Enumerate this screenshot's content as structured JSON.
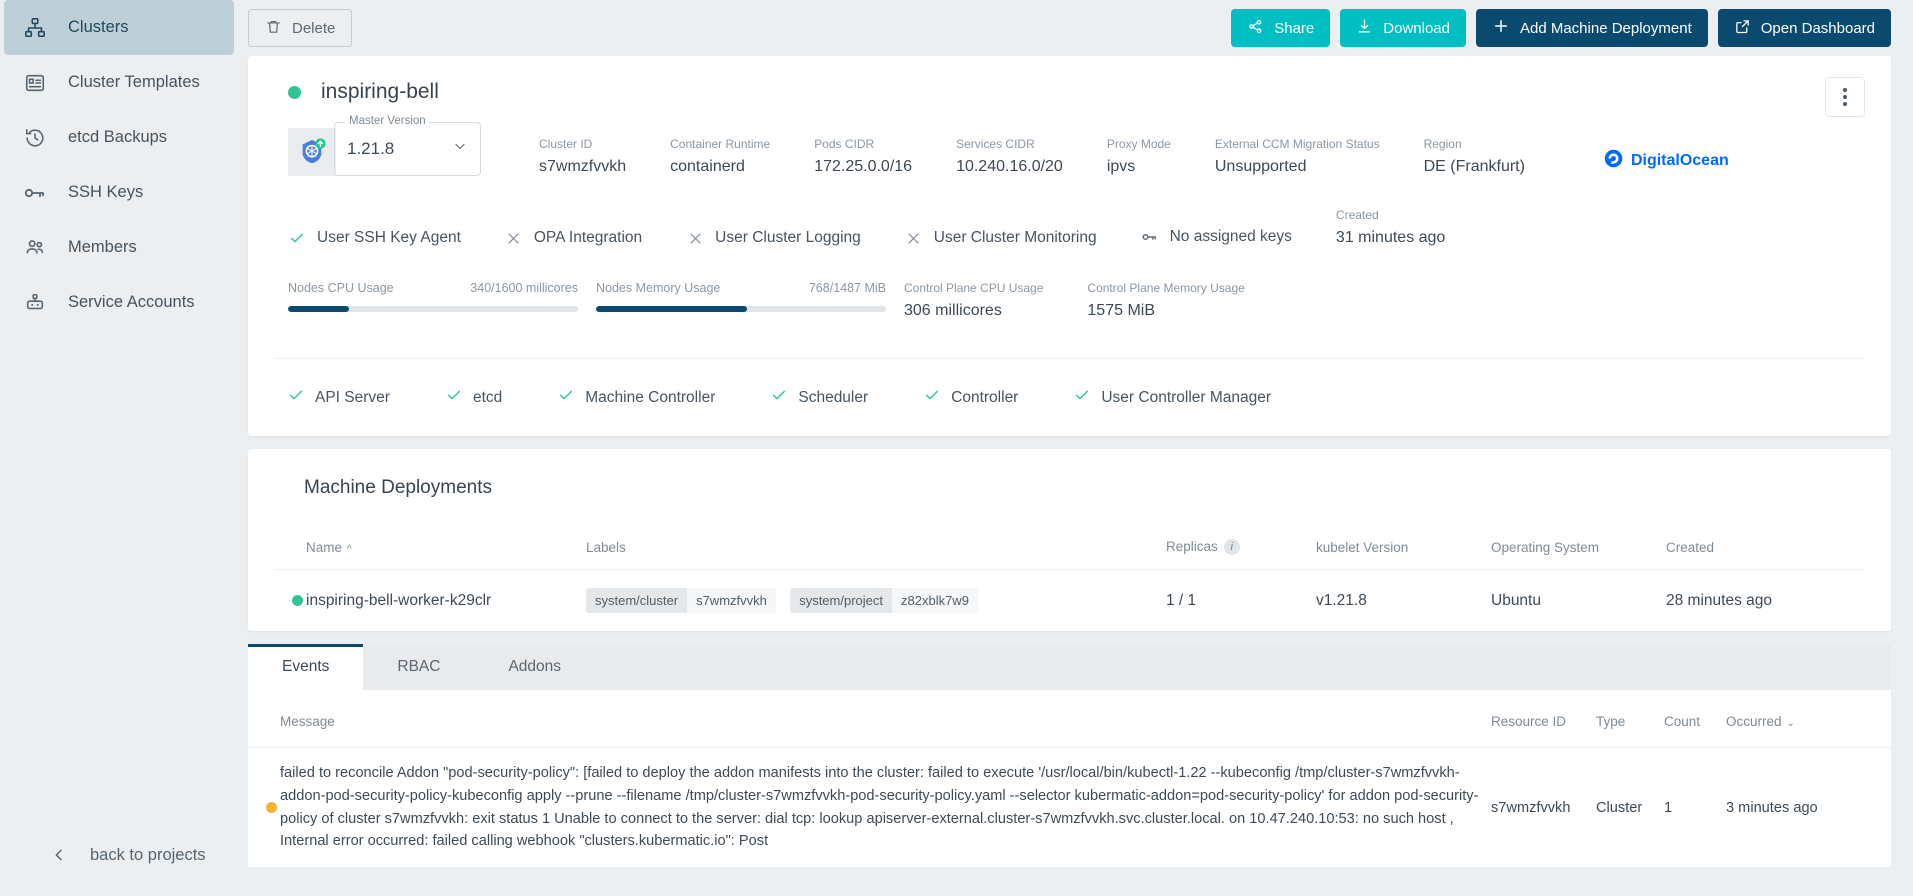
{
  "sidebar": {
    "items": [
      {
        "label": "Clusters",
        "icon": "clusters-icon",
        "active": true
      },
      {
        "label": "Cluster Templates",
        "icon": "template-icon",
        "active": false
      },
      {
        "label": "etcd Backups",
        "icon": "history-icon",
        "active": false
      },
      {
        "label": "SSH Keys",
        "icon": "key-icon",
        "active": false
      },
      {
        "label": "Members",
        "icon": "people-icon",
        "active": false
      },
      {
        "label": "Service Accounts",
        "icon": "robot-icon",
        "active": false
      }
    ],
    "back_label": "back to projects"
  },
  "toolbar": {
    "delete_label": "Delete",
    "share_label": "Share",
    "download_label": "Download",
    "add_md_label": "Add Machine Deployment",
    "open_dashboard_label": "Open Dashboard"
  },
  "cluster": {
    "name": "inspiring-bell",
    "status_color": "#30c691",
    "master_version_label": "Master Version",
    "master_version": "1.21.8",
    "meta": [
      {
        "label": "Cluster ID",
        "value": "s7wmzfvvkh"
      },
      {
        "label": "Container Runtime",
        "value": "containerd"
      },
      {
        "label": "Pods CIDR",
        "value": "172.25.0.0/16"
      },
      {
        "label": "Services CIDR",
        "value": "10.240.16.0/20"
      },
      {
        "label": "Proxy Mode",
        "value": "ipvs"
      },
      {
        "label": "External CCM Migration Status",
        "value": "Unsupported"
      },
      {
        "label": "Region",
        "value": "DE (Frankfurt)"
      }
    ],
    "provider": "DigitalOcean",
    "features": [
      {
        "label": "User SSH Key Agent",
        "state": "check"
      },
      {
        "label": "OPA Integration",
        "state": "cross"
      },
      {
        "label": "User Cluster Logging",
        "state": "cross"
      },
      {
        "label": "User Cluster Monitoring",
        "state": "cross"
      },
      {
        "label": "No assigned keys",
        "state": "key"
      }
    ],
    "created_label": "Created",
    "created_value": "31 minutes ago",
    "usage": [
      {
        "label": "Nodes CPU Usage",
        "value": "340/1600 millicores",
        "percent": 21
      },
      {
        "label": "Nodes Memory Usage",
        "value": "768/1487 MiB",
        "percent": 52
      }
    ],
    "usage_simple": [
      {
        "label": "Control Plane CPU Usage",
        "value": "306 millicores"
      },
      {
        "label": "Control Plane Memory Usage",
        "value": "1575 MiB"
      }
    ],
    "components": [
      "API Server",
      "etcd",
      "Machine Controller",
      "Scheduler",
      "Controller",
      "User Controller Manager"
    ]
  },
  "machine_deployments": {
    "title": "Machine Deployments",
    "columns": [
      "Name",
      "Labels",
      "Replicas",
      "kubelet Version",
      "Operating System",
      "Created"
    ],
    "sort_column": "Name",
    "sort_caret": "^",
    "rows": [
      {
        "status_color": "#30c691",
        "name": "inspiring-bell-worker-k29clr",
        "labels": [
          {
            "key": "system/cluster",
            "value": "s7wmzfvvkh"
          },
          {
            "key": "system/project",
            "value": "z82xblk7w9"
          }
        ],
        "replicas": "1 / 1",
        "kubelet_version": "v1.21.8",
        "operating_system": "Ubuntu",
        "created": "28 minutes ago"
      }
    ]
  },
  "tabs": [
    {
      "label": "Events",
      "active": true
    },
    {
      "label": "RBAC",
      "active": false
    },
    {
      "label": "Addons",
      "active": false
    }
  ],
  "events": {
    "columns": [
      "Message",
      "Resource ID",
      "Type",
      "Count",
      "Occurred"
    ],
    "sort_caret": "⌄",
    "rows": [
      {
        "status_color": "#f5b336",
        "message": "failed to reconcile Addon \"pod-security-policy\": [failed to deploy the addon manifests into the cluster: failed to execute '/usr/local/bin/kubectl-1.22 --kubeconfig /tmp/cluster-s7wmzfvvkh-addon-pod-security-policy-kubeconfig apply --prune --filename /tmp/cluster-s7wmzfvvkh-pod-security-policy.yaml --selector kubermatic-addon=pod-security-policy' for addon pod-security-policy of cluster s7wmzfvvkh: exit status 1 Unable to connect to the server: dial tcp: lookup apiserver-external.cluster-s7wmzfvvkh.svc.cluster.local. on 10.47.240.10:53: no such host , Internal error occurred: failed calling webhook \"clusters.kubermatic.io\": Post",
        "resource_id": "s7wmzfvvkh",
        "type": "Cluster",
        "count": "1",
        "occurred": "3 minutes ago"
      }
    ]
  },
  "colors": {
    "accent_teal": "#00bfc2",
    "accent_navy": "#0b4a6f",
    "status_green": "#30c691",
    "status_orange": "#f5b336",
    "provider_blue": "#0069ff",
    "page_bg": "#eceff1"
  }
}
